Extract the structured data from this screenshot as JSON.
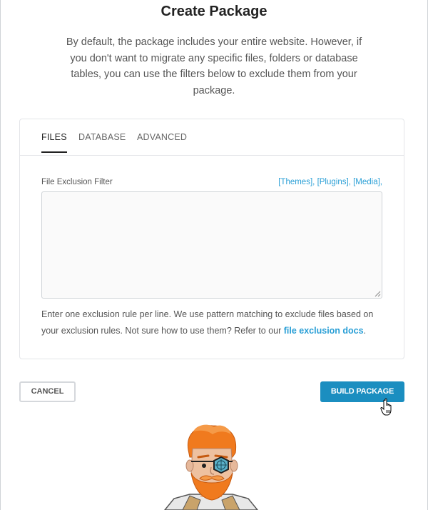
{
  "page": {
    "title": "Create Package",
    "intro": "By default, the package includes your entire website. However, if you don't want to migrate any specific files, folders or database tables, you can use the filters below to exclude them from your package."
  },
  "tabs": [
    {
      "label": "FILES",
      "active": true
    },
    {
      "label": "DATABASE",
      "active": false
    },
    {
      "label": "ADVANCED",
      "active": false
    }
  ],
  "filter": {
    "label": "File Exclusion Filter",
    "links": [
      "[Themes]",
      "[Plugins]",
      "[Media]"
    ],
    "separator": ",",
    "value": "",
    "help_text": "Enter one exclusion rule per line. We use pattern matching to exclude files based on your exclusion rules. Not sure how to use them? Refer to our ",
    "help_link": "file exclusion docs",
    "help_end": "."
  },
  "actions": {
    "cancel_label": "CANCEL",
    "build_label": "BUILD PACKAGE"
  },
  "colors": {
    "accent": "#1b8ec0",
    "link": "#2a9fd6"
  },
  "icons": {
    "cursor": "hand-pointer-icon",
    "mascot": "mascot-illustration"
  }
}
